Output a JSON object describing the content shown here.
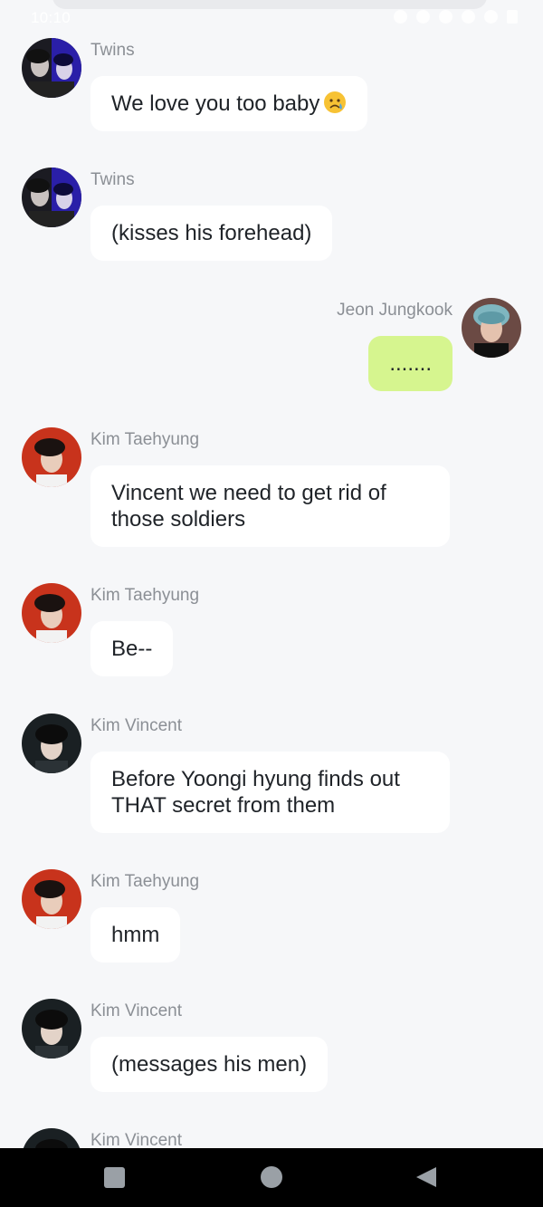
{
  "status_bar": {
    "time": "10:10"
  },
  "messages": [
    {
      "sender": "Twins",
      "text": "We love you too baby",
      "emoji": "worried-face-icon",
      "side": "left",
      "avatar": "twins-avatar"
    },
    {
      "sender": "Twins",
      "text": "(kisses his forehead)",
      "side": "left",
      "avatar": "twins-avatar"
    },
    {
      "sender": "Jeon Jungkook",
      "text": ".......",
      "side": "right",
      "avatar": "jungkook-avatar"
    },
    {
      "sender": "Kim Taehyung",
      "text": "Vincent we need to get rid of those soldiers",
      "side": "left",
      "avatar": "taehyung-avatar"
    },
    {
      "sender": "Kim Taehyung",
      "text": "Be--",
      "side": "left",
      "avatar": "taehyung-avatar"
    },
    {
      "sender": "Kim Vincent",
      "text": "Before Yoongi hyung finds out THAT secret from them",
      "side": "left",
      "avatar": "vincent-avatar"
    },
    {
      "sender": "Kim Taehyung",
      "text": "hmm",
      "side": "left",
      "avatar": "taehyung-avatar"
    },
    {
      "sender": "Kim Vincent",
      "text": "(messages his men)",
      "side": "left",
      "avatar": "vincent-avatar"
    },
    {
      "sender": "Kim Vincent",
      "text": "",
      "side": "left",
      "avatar": "vincent-avatar"
    }
  ],
  "colors": {
    "background": "#f6f7f9",
    "bubble_incoming": "#ffffff",
    "bubble_outgoing": "#d6f58f",
    "sender_text": "#8b8f95"
  },
  "nav_bar": {
    "icons": [
      "recent-apps-icon",
      "home-icon",
      "back-icon"
    ]
  }
}
